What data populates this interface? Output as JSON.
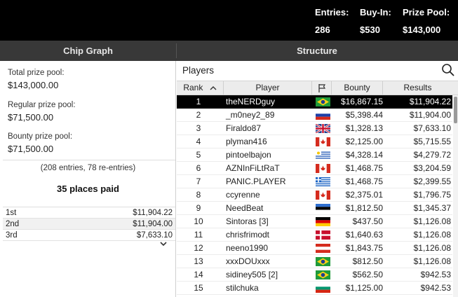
{
  "header": {
    "entries_label": "Entries:",
    "entries_value": "286",
    "buyin_label": "Buy-In:",
    "buyin_value": "$530",
    "prizepool_label": "Prize Pool:",
    "prizepool_value": "$143,000"
  },
  "tabs": {
    "chip_graph": "Chip Graph",
    "structure": "Structure"
  },
  "summary": {
    "total_label": "Total prize pool:",
    "total_value": "$143,000.00",
    "regular_label": "Regular prize pool:",
    "regular_value": "$71,500.00",
    "bounty_label": "Bounty prize pool:",
    "bounty_value": "$71,500.00",
    "entries_note": "(208 entries, 78 re-entries)",
    "places_paid": "35 places paid"
  },
  "payouts": [
    {
      "place": "1st",
      "amount": "$11,904.22"
    },
    {
      "place": "2nd",
      "amount": "$11,904.00"
    },
    {
      "place": "3rd",
      "amount": "$7,633.10"
    }
  ],
  "players_panel": {
    "title": "Players",
    "columns": {
      "rank": "Rank",
      "player": "Player",
      "bounty": "Bounty",
      "results": "Results"
    },
    "rows": [
      {
        "rank": "1",
        "player": "theNERDguy",
        "flag": "br",
        "bounty": "$16,867.15",
        "results": "$11,904.22"
      },
      {
        "rank": "2",
        "player": "_m0ney2_89",
        "flag": "ru",
        "bounty": "$5,398.44",
        "results": "$11,904.00"
      },
      {
        "rank": "3",
        "player": "Firaldo87",
        "flag": "gb",
        "bounty": "$1,328.13",
        "results": "$7,633.10"
      },
      {
        "rank": "4",
        "player": "plyman416",
        "flag": "ca",
        "bounty": "$2,125.00",
        "results": "$5,715.55"
      },
      {
        "rank": "5",
        "player": "pintoelbajon",
        "flag": "uy",
        "bounty": "$4,328.14",
        "results": "$4,279.72"
      },
      {
        "rank": "6",
        "player": "AZNInFiLtRaT",
        "flag": "ca",
        "bounty": "$1,468.75",
        "results": "$3,204.59"
      },
      {
        "rank": "7",
        "player": "PANIC.PLAYER",
        "flag": "gr",
        "bounty": "$1,468.75",
        "results": "$2,399.55"
      },
      {
        "rank": "8",
        "player": "ccyrenne",
        "flag": "ca",
        "bounty": "$2,375.01",
        "results": "$1,796.75"
      },
      {
        "rank": "9",
        "player": "NeedBeat",
        "flag": "ee",
        "bounty": "$1,812.50",
        "results": "$1,345.37"
      },
      {
        "rank": "10",
        "player": "Sintoras [3]",
        "flag": "de",
        "bounty": "$437.50",
        "results": "$1,126.08"
      },
      {
        "rank": "11",
        "player": "chrisfrimodt",
        "flag": "dk",
        "bounty": "$1,640.63",
        "results": "$1,126.08"
      },
      {
        "rank": "12",
        "player": "neeno1990",
        "flag": "at",
        "bounty": "$1,843.75",
        "results": "$1,126.08"
      },
      {
        "rank": "13",
        "player": "xxxDOUxxx",
        "flag": "br",
        "bounty": "$812.50",
        "results": "$1,126.08"
      },
      {
        "rank": "14",
        "player": "sidiney505 [2]",
        "flag": "br",
        "bounty": "$562.50",
        "results": "$942.53"
      },
      {
        "rank": "15",
        "player": "stilchuka",
        "flag": "bg",
        "bounty": "$1,125.00",
        "results": "$942.53"
      }
    ]
  },
  "colors": {
    "header_bg": "#000000",
    "tabs_bg": "#383838",
    "selected_row_bg": "#000000"
  }
}
